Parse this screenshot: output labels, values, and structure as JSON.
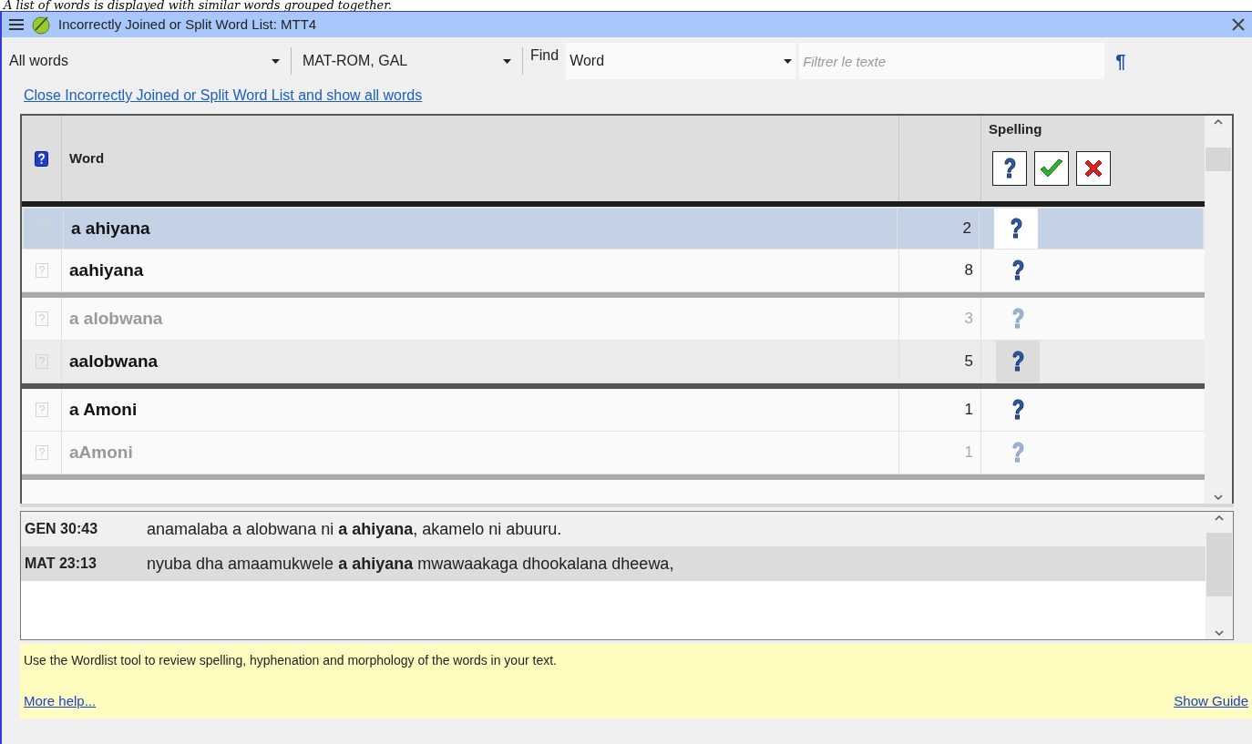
{
  "caption": "A list of words is displayed with similar words grouped together.",
  "window": {
    "title": "Incorrectly Joined or Split Word List: MTT4"
  },
  "toolbar": {
    "filter": "All words",
    "books": "MAT-ROM, GAL",
    "find_label": "Find",
    "find_field": "Word",
    "search": {
      "placeholder": "Filtrer le texte"
    },
    "pilcrow": "¶"
  },
  "close_link": "Close Incorrectly Joined or Split Word List and show all words",
  "table": {
    "columns": [
      "Word",
      "Spelling"
    ],
    "groups": [
      {
        "dark_divider": false,
        "rows": [
          {
            "word": "a ahiyana",
            "count": "2",
            "selected": true,
            "dimmed": false,
            "hovered": false
          },
          {
            "word": "aahiyana",
            "count": "8",
            "selected": false,
            "dimmed": false,
            "hovered": false
          }
        ]
      },
      {
        "dark_divider": true,
        "rows": [
          {
            "word": "a alobwana",
            "count": "3",
            "selected": false,
            "dimmed": true,
            "hovered": false
          },
          {
            "word": "aalobwana",
            "count": "5",
            "selected": false,
            "dimmed": false,
            "hovered": true
          }
        ]
      },
      {
        "dark_divider": false,
        "rows": [
          {
            "word": "a Amoni",
            "count": "1",
            "selected": false,
            "dimmed": false,
            "hovered": false
          },
          {
            "word": "aAmoni",
            "count": "1",
            "selected": false,
            "dimmed": true,
            "hovered": false
          }
        ]
      }
    ]
  },
  "references": [
    {
      "ref": "GEN 30:43",
      "text": "anamalaba a alobwana ni **a ahiyana**, akamelo ni abuuru.",
      "selected": false
    },
    {
      "ref": "MAT 23:13",
      "text": "nyuba dha amaamukwele **a ahiyana** mwawaakaga dhookalana dheewa,",
      "selected": true
    }
  ],
  "help": {
    "text": "Use the Wordlist tool to review spelling, hyphenation and morphology of the words in your text.",
    "more_link": "More help...",
    "guide_link": "Show Guide"
  }
}
